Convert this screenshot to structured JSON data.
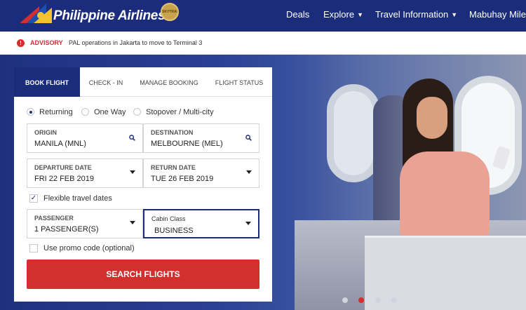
{
  "header": {
    "brand": "Philippine Airlines",
    "award_badge": "SKYTRAX",
    "nav": [
      {
        "label": "Deals",
        "has_dropdown": false
      },
      {
        "label": "Explore",
        "has_dropdown": true
      },
      {
        "label": "Travel Information",
        "has_dropdown": true
      },
      {
        "label": "Mabuhay Miles",
        "has_dropdown": false
      }
    ],
    "icons": {
      "logo": "pal-sun-logo-icon",
      "dropdown": "chevron-down-icon"
    }
  },
  "advisory": {
    "icon": "alert-icon",
    "icon_glyph": "!",
    "label": "ADVISORY",
    "text": "PAL operations in Jakarta to move to Terminal 3"
  },
  "booking": {
    "tabs": [
      {
        "label": "BOOK FLIGHT",
        "active": true
      },
      {
        "label": "CHECK - IN",
        "active": false
      },
      {
        "label": "MANAGE BOOKING",
        "active": false
      },
      {
        "label": "FLIGHT STATUS",
        "active": false
      }
    ],
    "trip_types": [
      {
        "label": "Returning",
        "selected": true
      },
      {
        "label": "One Way",
        "selected": false
      },
      {
        "label": "Stopover / Multi-city",
        "selected": false
      }
    ],
    "origin": {
      "label": "ORIGIN",
      "value": "MANILA (MNL)",
      "icon": "search-icon"
    },
    "destination": {
      "label": "DESTINATION",
      "value": "MELBOURNE (MEL)",
      "icon": "search-icon"
    },
    "departure": {
      "label": "DEPARTURE DATE",
      "value": "FRI 22 FEB 2019"
    },
    "return": {
      "label": "RETURN DATE",
      "value": "TUE 26 FEB 2019"
    },
    "flexible": {
      "label": "Flexible travel dates",
      "checked": true,
      "check_glyph": "✓"
    },
    "passenger": {
      "label": "PASSENGER",
      "value": "1 PASSENGER(S)"
    },
    "cabin": {
      "label": "Cabin Class",
      "value": "BUSINESS"
    },
    "promo": {
      "label": "Use promo code (optional)",
      "checked": false
    },
    "search_button": "SEARCH FLIGHTS"
  },
  "hero": {
    "carousel": {
      "count": 4,
      "active_index": 1
    }
  },
  "colors": {
    "brand_blue": "#1b2d7a",
    "accent_red": "#d32f2f",
    "gold": "#c9a34b"
  }
}
